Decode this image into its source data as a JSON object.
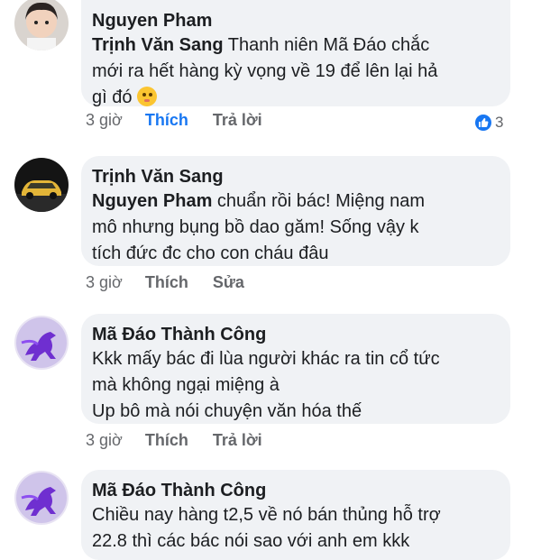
{
  "comments": [
    {
      "author": "Nguyen Pham",
      "mention": "Trịnh Văn Sang",
      "lines": [
        "Thanh niên Mã Đáo chắc",
        "mới ra hết hàng kỳ vọng về 19 để lên lại hả",
        "gì đó"
      ],
      "emoji": "shushing-face",
      "time": "3 giờ",
      "like_label": "Thích",
      "reply_label": "Trả lời",
      "reaction_count": "3",
      "liked": true
    },
    {
      "author": "Trịnh Văn Sang",
      "mention": "Nguyen Pham",
      "lines": [
        "chuẩn rồi bác! Miệng nam",
        "mô nhưng bụng bồ dao găm! Sống vậy k",
        "tích đức đc cho con cháu đâu"
      ],
      "time": "3 giờ",
      "like_label": "Thích",
      "edit_label": "Sửa"
    },
    {
      "author": "Mã Đáo Thành Công",
      "lines": [
        "Kkk mấy bác đi lùa người khác ra tin cổ tức",
        "mà không ngại miệng à",
        "Up bô mà nói chuyện văn hóa thế"
      ],
      "time": "3 giờ",
      "like_label": "Thích",
      "reply_label": "Trả lời"
    },
    {
      "author": "Mã Đáo Thành Công",
      "lines": [
        "Chiều nay hàng t2,5 về nó bán thủng hỗ trợ",
        "22.8 thì các bác nói sao với anh em kkk"
      ]
    }
  ],
  "colors": {
    "bubble": "#f0f2f5",
    "liked": "#1877f2",
    "meta": "#65676b"
  }
}
